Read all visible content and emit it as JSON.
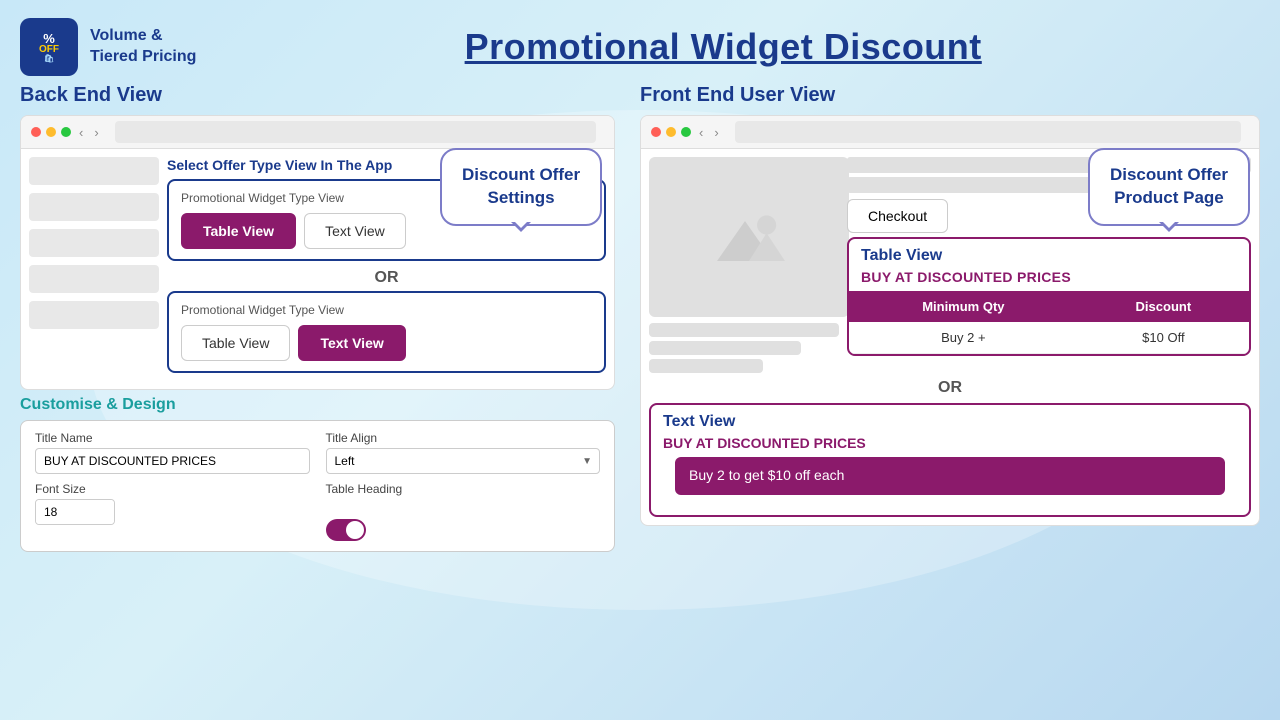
{
  "header": {
    "logo_text_line1": "%",
    "logo_text_line2": "OFF",
    "brand_name_line1": "Volume &",
    "brand_name_line2": "Tiered Pricing",
    "page_title": "Promotional Widget Discount"
  },
  "left_section": {
    "section_title": "Back End View",
    "select_offer_label": "Select Offer Type View In The App",
    "bubble_label_line1": "Discount Offer",
    "bubble_label_line2": "Settings",
    "widget_box_1": {
      "label": "Promotional Widget Type View",
      "btn_table": "Table View",
      "btn_text": "Text View",
      "active": "table"
    },
    "or_text": "OR",
    "widget_box_2": {
      "label": "Promotional Widget Type View",
      "btn_table": "Table View",
      "btn_text": "Text View",
      "active": "text"
    },
    "customise_label": "Customise & Design",
    "form": {
      "title_name_label": "Title Name",
      "title_name_value": "BUY AT DISCOUNTED PRICES",
      "title_align_label": "Title Align",
      "title_align_value": "Left",
      "font_size_label": "Font Size",
      "font_size_value": "18",
      "font_size_unit": "px",
      "table_heading_label": "Table Heading",
      "toggle_state": "on"
    }
  },
  "right_section": {
    "section_title": "Front End User View",
    "bubble_label_line1": "Discount Offer",
    "bubble_label_line2": "Product Page",
    "checkout_btn": "Checkout",
    "table_widget": {
      "title": "Table View",
      "buy_title": "BUY AT DISCOUNTED PRICES",
      "col_min_qty": "Minimum Qty",
      "col_discount": "Discount",
      "row_qty": "Buy 2 +",
      "row_discount": "$10 Off"
    },
    "or_text": "OR",
    "text_widget": {
      "title": "Text View",
      "buy_title": "BUY AT DISCOUNTED PRICES",
      "offer_text": "Buy 2 to get $10 off each"
    }
  }
}
